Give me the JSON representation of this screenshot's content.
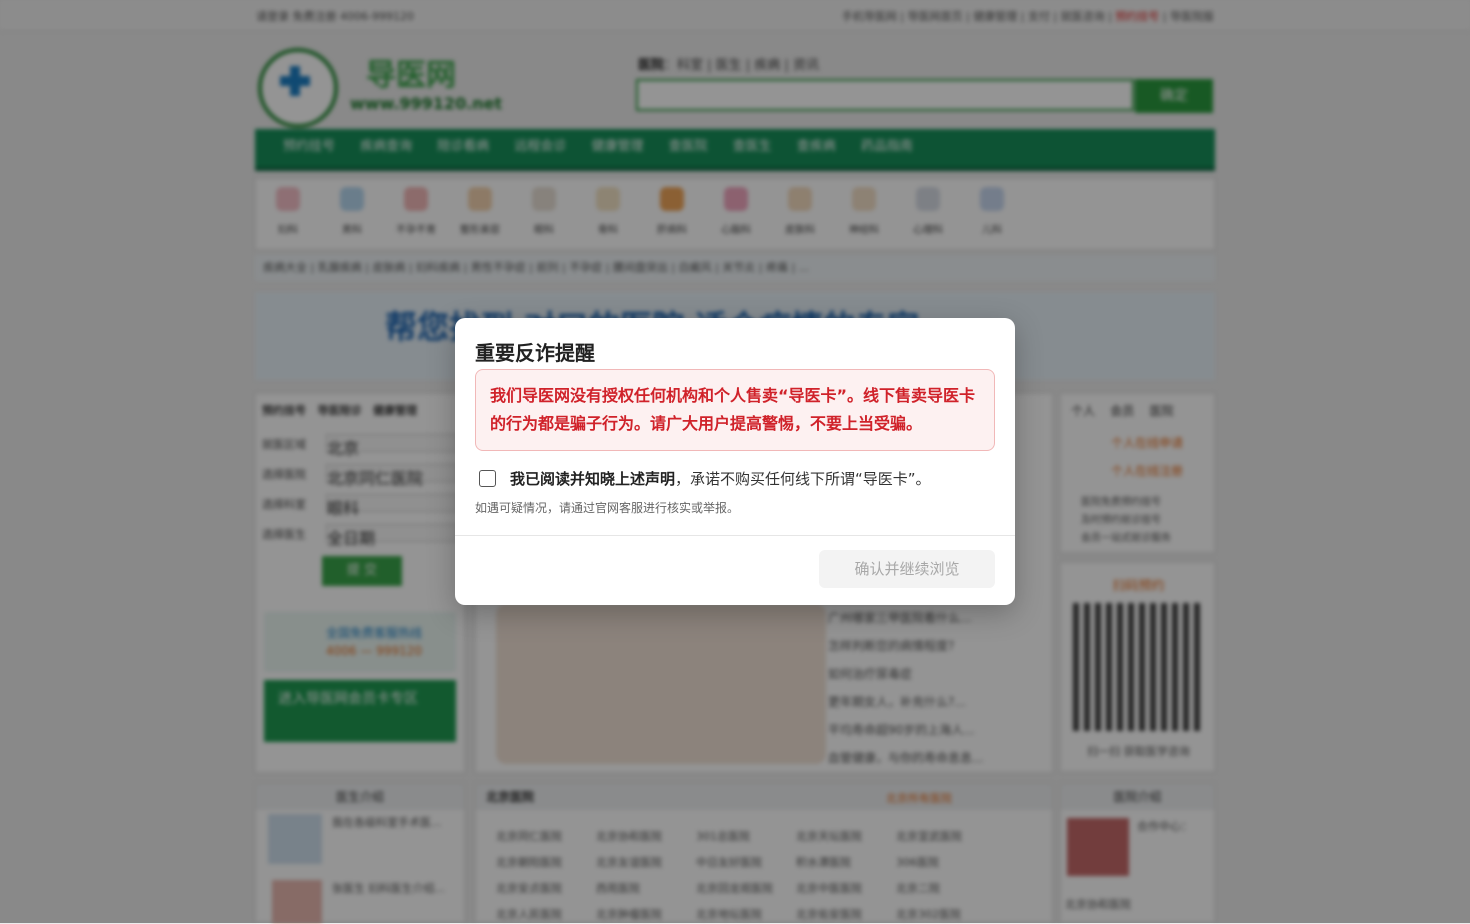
{
  "site": {
    "top_left": "请登录  免费注册  4006-999120",
    "top_right_items": [
      "手机导医网",
      "导医网首页",
      "健康管理",
      "支付",
      "就医咨询"
    ],
    "top_right_hot": "预约挂号",
    "top_right_last": "导医院版",
    "logo_name": "导医网",
    "logo_url": "www.999120.net",
    "search_tabs_active": "医院",
    "search_tabs_rest": "：科室 | 医生 | 疾病 | 资讯",
    "search_button": "确定",
    "nav_items": [
      "预约挂号",
      "疾病查询",
      "陪诊看病",
      "远程会诊",
      "健康管理",
      "查医院",
      "查医生",
      "查疾病",
      "药品指南"
    ],
    "departments": [
      "妇科",
      "男科",
      "不孕不育",
      "整形美容",
      "眼科",
      "骨科",
      "肝病科",
      "心脑科",
      "皮肤科",
      "神经科",
      "心理科",
      "儿科"
    ],
    "keywords": "疾病大全 | 乳腺疾病 | 皮肤病 | 妇科疾病 | 男性不孕症 | 前列 | 不孕症 | 腰间盘突出 | 白癜风 | 关节炎 | 疼痛 | ...",
    "banner_text": "帮您找到 对口的医院 适合病情的专家",
    "left_tabs": [
      "预约挂号",
      "导医陪诊",
      "健康管理"
    ],
    "form_labels": [
      "就医区域",
      "选择医院",
      "选择科室",
      "选择医生"
    ],
    "form_values": [
      "北京",
      "北京同仁医院",
      "眼科",
      "全日期"
    ],
    "form_submit": "提 交",
    "hotline_title": "全国免费客服热线",
    "hotline_number": "4006 — 999120",
    "vip_card": "进入导医网会员卡专区",
    "news": [
      "广州哪家三甲医院看什么...",
      "怎样判断您的病情程度?",
      "如何治疗尿毒症",
      "更年期女人，补充什么?...",
      "平均寿命超90岁的上海人...",
      "血管健康，与你的寿命息息..."
    ],
    "right_tabs": [
      "个人",
      "会员",
      "医院"
    ],
    "right_links": [
      "个人在线申请",
      "个人在线注册"
    ],
    "right_bullets": [
      "医院免费预约挂号",
      "及时预约就诊挂号",
      "会员一站式就诊服务"
    ],
    "qr_title": "扫码预约",
    "qr_caption": "扫一扫 获取医学咨询",
    "doctor_header": "医生介绍",
    "doctors": [
      "我在各级科室手术医...",
      "张医生 妇科医生介绍..."
    ],
    "hosp_header": "北京医院",
    "hosp_more": "北京所有医院",
    "hospitals": [
      "北京同仁医院",
      "北京协和医院",
      "301总医院",
      "北京天坛医院",
      "北京宣武医院",
      "北京朝阳医院",
      "北京友谊医院",
      "中日友好医院",
      "积水潭医院",
      "306医院",
      "北京安贞医院",
      "西苑医院",
      "北京回龙观医院",
      "北京中医医院",
      "北京二院",
      "北京人民医院",
      "北京肿瘤医院",
      "北京地坛医院",
      "北京佑安医院",
      "北京302医院"
    ],
    "right_bottom_header": "医院介绍",
    "right_bottom_item": "合作中心：",
    "right_bottom_item2": "北京协和医院"
  },
  "modal": {
    "title": "重要反诈提醒",
    "warning": "我们导医网没有授权任何机构和个人售卖“导医卡”。线下售卖导医卡的行为都是骗子行为。请广大用户提高警惕，不要上当受骗。",
    "agree_strong": "我已阅读并知晓上述声明",
    "agree_rest": "，承诺不购买任何线下所谓“导医卡”。",
    "hint": "如遇可疑情况，请通过官网客服进行核实或举报。",
    "confirm_button": "确认并继续浏览",
    "checkbox_checked": false
  },
  "colors": {
    "brand_green": "#17905a",
    "warning_red": "#d0222a",
    "warning_bg": "#fdf1f1"
  }
}
